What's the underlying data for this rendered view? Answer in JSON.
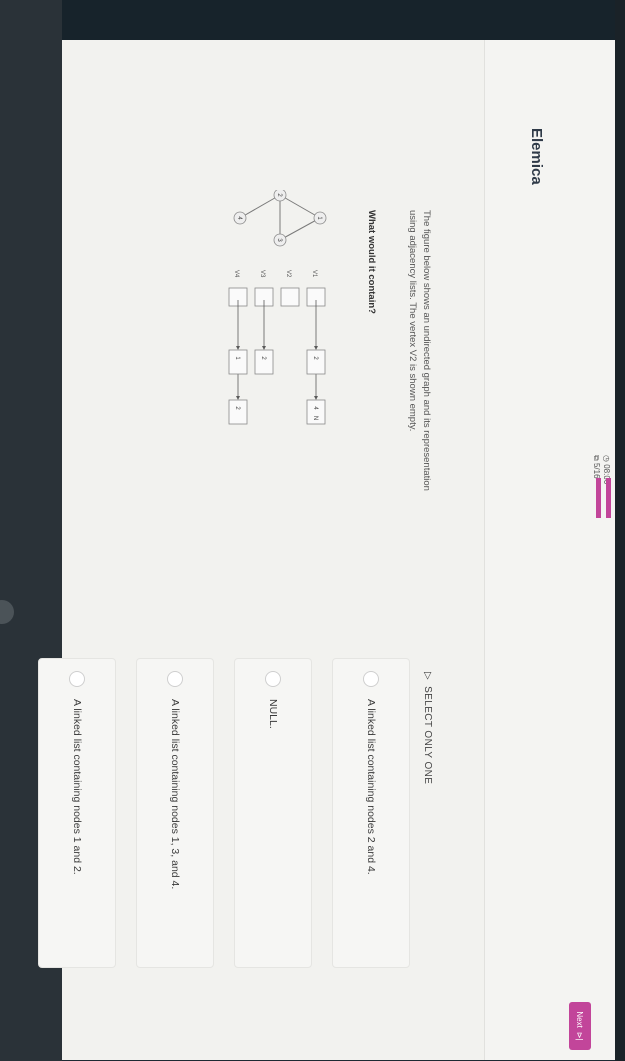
{
  "app": {
    "name": "Elemica"
  },
  "header": {
    "timer": "08:06",
    "progress": "5/16",
    "next_label": "Next",
    "accent": "#c2459a"
  },
  "question": {
    "text": "The figure below shows an undirected graph and its representation using adjacency lists. The vertex V2 is shown empty.",
    "ask": "What would it contain?"
  },
  "graph": {
    "nodes": [
      "1",
      "2",
      "3",
      "4"
    ],
    "vertices": [
      "V1",
      "V2",
      "V3",
      "V4"
    ],
    "lists": {
      "v1": [
        "2",
        "4",
        "N"
      ],
      "v3": [
        "2"
      ],
      "v4": [
        "1",
        "2"
      ]
    }
  },
  "answers": {
    "select_label": "SELECT ONLY ONE",
    "options": [
      "A linked list containing nodes 2 and 4.",
      "NULL.",
      "A linked list containing nodes 1, 3, and 4.",
      "A linked list containing nodes 1 and 2."
    ]
  }
}
